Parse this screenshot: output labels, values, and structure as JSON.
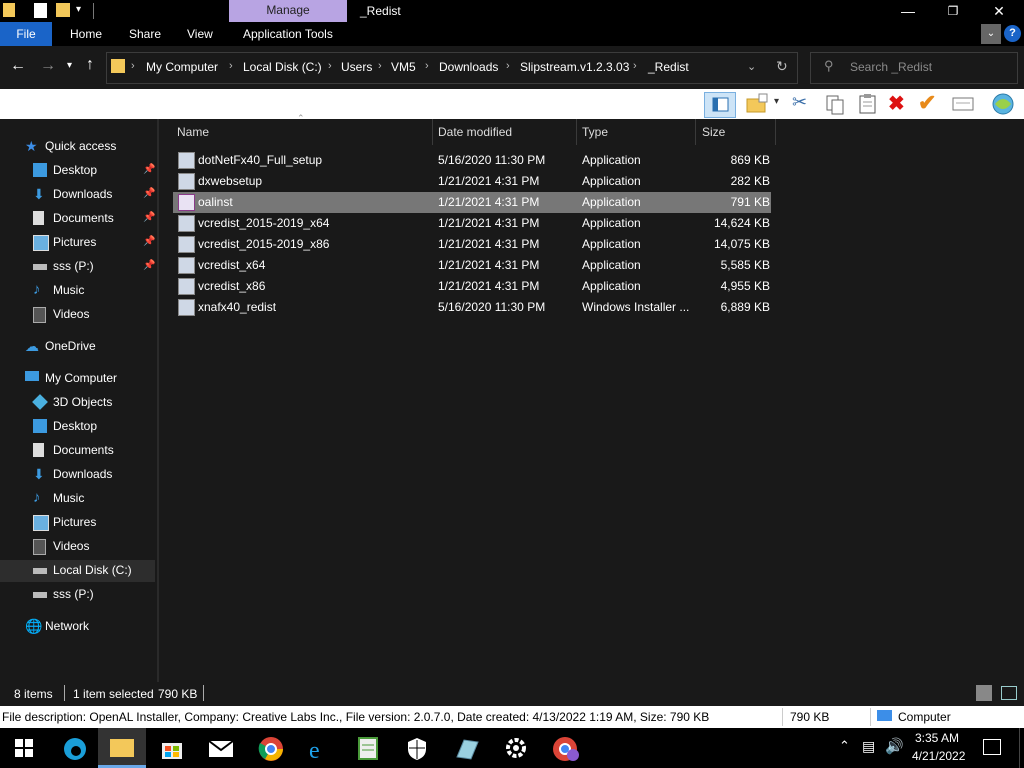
{
  "window": {
    "title": "_Redist",
    "context_tab": "Manage",
    "minimize": "—",
    "maximize": "❐",
    "close": "✕"
  },
  "ribbon": {
    "tabs": [
      {
        "label": "File"
      },
      {
        "label": "Home"
      },
      {
        "label": "Share"
      },
      {
        "label": "View"
      },
      {
        "label": "Application Tools"
      }
    ]
  },
  "address": {
    "crumbs": [
      "My Computer",
      "Local Disk (C:)",
      "Users",
      "VM5",
      "Downloads",
      "Slipstream.v1.2.3.03",
      "_Redist"
    ],
    "search_placeholder": "Search _Redist"
  },
  "sidebar": {
    "items": [
      {
        "label": "Quick access",
        "icon": "star-icon",
        "pinned": false
      },
      {
        "label": "Desktop",
        "icon": "desktop-icon",
        "pinned": true
      },
      {
        "label": "Downloads",
        "icon": "download-icon",
        "pinned": true
      },
      {
        "label": "Documents",
        "icon": "document-icon",
        "pinned": true
      },
      {
        "label": "Pictures",
        "icon": "pictures-icon",
        "pinned": true
      },
      {
        "label": "sss (P:)",
        "icon": "drive-icon",
        "pinned": true
      },
      {
        "label": "Music",
        "icon": "music-icon",
        "pinned": false
      },
      {
        "label": "Videos",
        "icon": "videos-icon",
        "pinned": false
      },
      {
        "label": "OneDrive",
        "icon": "cloud-icon",
        "pinned": false
      },
      {
        "label": "My Computer",
        "icon": "computer-icon",
        "pinned": false
      },
      {
        "label": "3D Objects",
        "icon": "cube-icon",
        "pinned": false
      },
      {
        "label": "Desktop",
        "icon": "desktop-icon",
        "pinned": false
      },
      {
        "label": "Documents",
        "icon": "document-icon",
        "pinned": false
      },
      {
        "label": "Downloads",
        "icon": "download-icon",
        "pinned": false
      },
      {
        "label": "Music",
        "icon": "music-icon",
        "pinned": false
      },
      {
        "label": "Pictures",
        "icon": "pictures-icon",
        "pinned": false
      },
      {
        "label": "Videos",
        "icon": "videos-icon",
        "pinned": false
      },
      {
        "label": "Local Disk (C:)",
        "icon": "drive-icon",
        "pinned": false
      },
      {
        "label": "sss (P:)",
        "icon": "drive-icon",
        "pinned": false
      },
      {
        "label": "Network",
        "icon": "network-icon",
        "pinned": false
      }
    ]
  },
  "table": {
    "columns": [
      "Name",
      "Date modified",
      "Type",
      "Size"
    ],
    "rows": [
      {
        "name": "dotNetFx40_Full_setup",
        "date": "5/16/2020 11:30 PM",
        "type": "Application",
        "size": "869 KB"
      },
      {
        "name": "dxwebsetup",
        "date": "1/21/2021 4:31 PM",
        "type": "Application",
        "size": "282 KB"
      },
      {
        "name": "oalinst",
        "date": "1/21/2021 4:31 PM",
        "type": "Application",
        "size": "791 KB"
      },
      {
        "name": "vcredist_2015-2019_x64",
        "date": "1/21/2021 4:31 PM",
        "type": "Application",
        "size": "14,624 KB"
      },
      {
        "name": "vcredist_2015-2019_x86",
        "date": "1/21/2021 4:31 PM",
        "type": "Application",
        "size": "14,075 KB"
      },
      {
        "name": "vcredist_x64",
        "date": "1/21/2021 4:31 PM",
        "type": "Application",
        "size": "5,585 KB"
      },
      {
        "name": "vcredist_x86",
        "date": "1/21/2021 4:31 PM",
        "type": "Application",
        "size": "4,955 KB"
      },
      {
        "name": "xnafx40_redist",
        "date": "5/16/2020 11:30 PM",
        "type": "Windows Installer ...",
        "size": "6,889 KB"
      }
    ]
  },
  "status": {
    "items": "8 items",
    "selected": "1 item selected",
    "size": "790 KB"
  },
  "info": {
    "description": "File description: OpenAL Installer, Company: Creative Labs Inc., File version: 2.0.7.0, Date created: 4/13/2022 1:19 AM, Size: 790 KB",
    "size": "790 KB",
    "location": "Computer"
  },
  "taskbar": {
    "time": "3:35 AM",
    "date": "4/21/2022"
  },
  "colors": {
    "accent": "#1a64c8",
    "manage_tab": "#b8a4e3",
    "selection": "#777777"
  }
}
